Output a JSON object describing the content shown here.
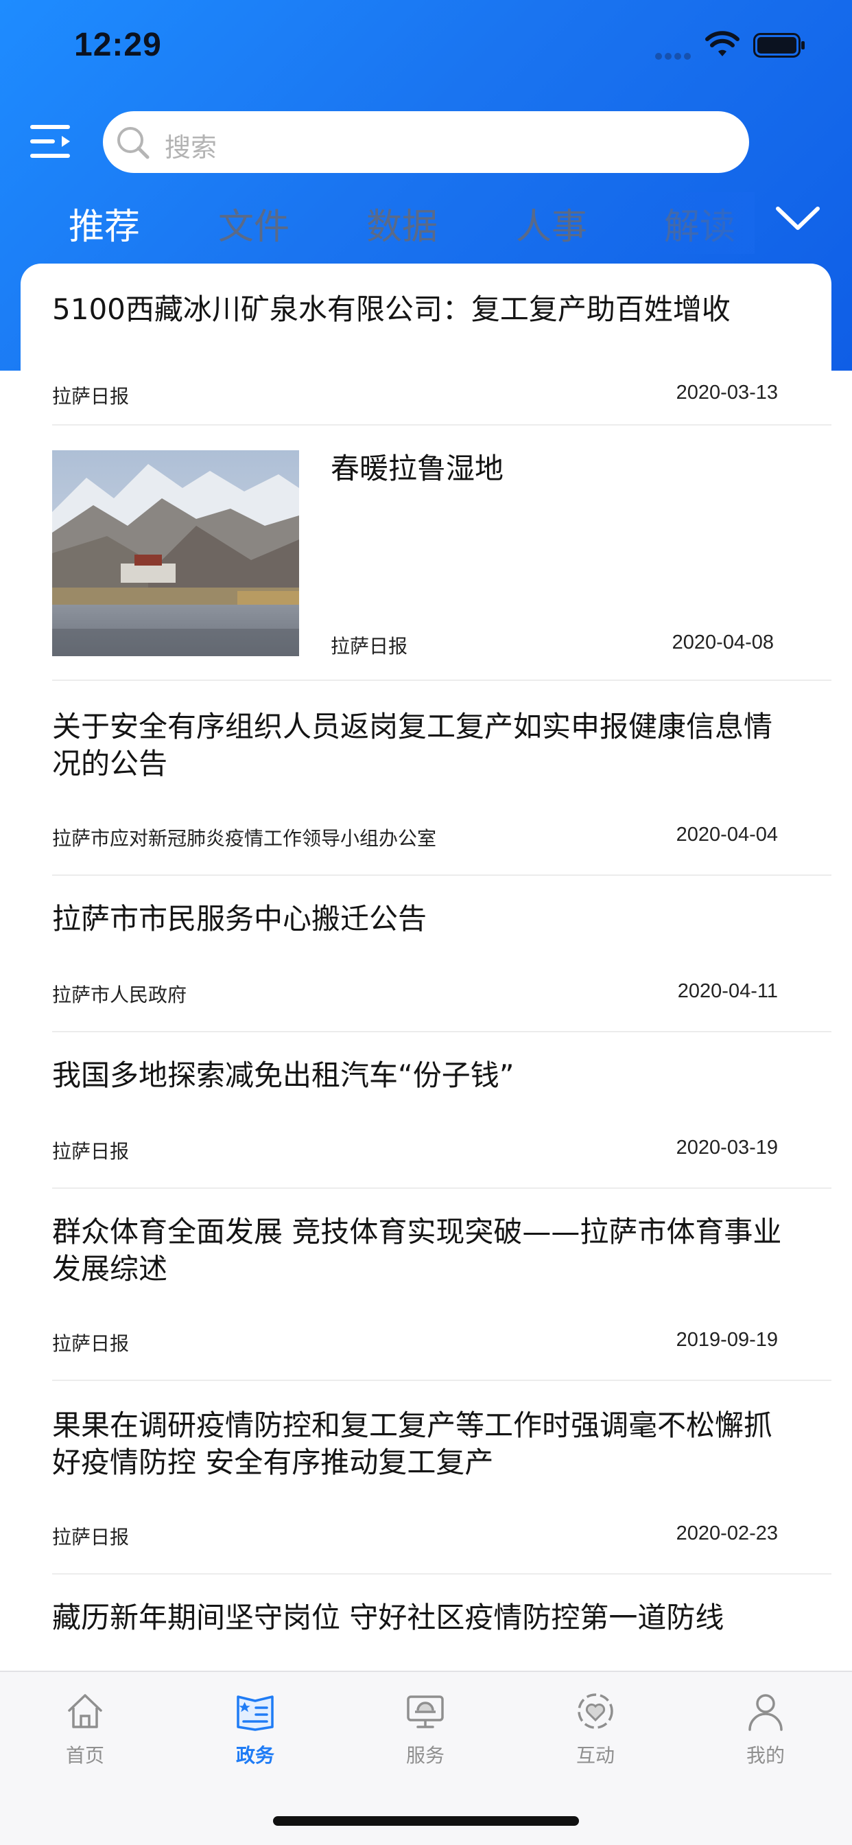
{
  "status_bar": {
    "time": "12:29"
  },
  "search": {
    "placeholder": "搜索"
  },
  "tabs": [
    {
      "label": "推荐",
      "active": true
    },
    {
      "label": "文件",
      "active": false
    },
    {
      "label": "数据",
      "active": false
    },
    {
      "label": "人事",
      "active": false
    },
    {
      "label": "解读",
      "active": false
    }
  ],
  "news": [
    {
      "title": "5100西藏冰川矿泉水有限公司：复工复产助百姓增收",
      "source": "拉萨日报",
      "date": "2020-03-13"
    },
    {
      "title": "春暖拉鲁湿地",
      "source": "拉萨日报",
      "date": "2020-04-08",
      "has_image": true
    },
    {
      "title": "关于安全有序组织人员返岗复工复产如实申报健康信息情况的公告",
      "source": "拉萨市应对新冠肺炎疫情工作领导小组办公室",
      "date": "2020-04-04"
    },
    {
      "title": "拉萨市市民服务中心搬迁公告",
      "source": "拉萨市人民政府",
      "date": "2020-04-11"
    },
    {
      "title": "我国多地探索减免出租汽车“份子钱”",
      "source": "拉萨日报",
      "date": "2020-03-19"
    },
    {
      "title": "群众体育全面发展 竞技体育实现突破——拉萨市体育事业发展综述",
      "source": "拉萨日报",
      "date": "2019-09-19"
    },
    {
      "title": "果果在调研疫情防控和复工复产等工作时强调毫不松懈抓好疫情防控 安全有序推动复工复产",
      "source": "拉萨日报",
      "date": "2020-02-23"
    },
    {
      "title": "藏历新年期间坚守岗位 守好社区疫情防控第一道防线",
      "source": "",
      "date": ""
    }
  ],
  "tabbar": [
    {
      "label": "首页",
      "icon": "home-icon",
      "active": false
    },
    {
      "label": "政务",
      "icon": "gov-affairs-icon",
      "active": true
    },
    {
      "label": "服务",
      "icon": "service-icon",
      "active": false
    },
    {
      "label": "互动",
      "icon": "interaction-icon",
      "active": false
    },
    {
      "label": "我的",
      "icon": "profile-icon",
      "active": false
    }
  ],
  "colors": {
    "accent": "#1f7cf5",
    "header_gradient_start": "#1e8cff",
    "header_gradient_end": "#0f5ee6"
  }
}
